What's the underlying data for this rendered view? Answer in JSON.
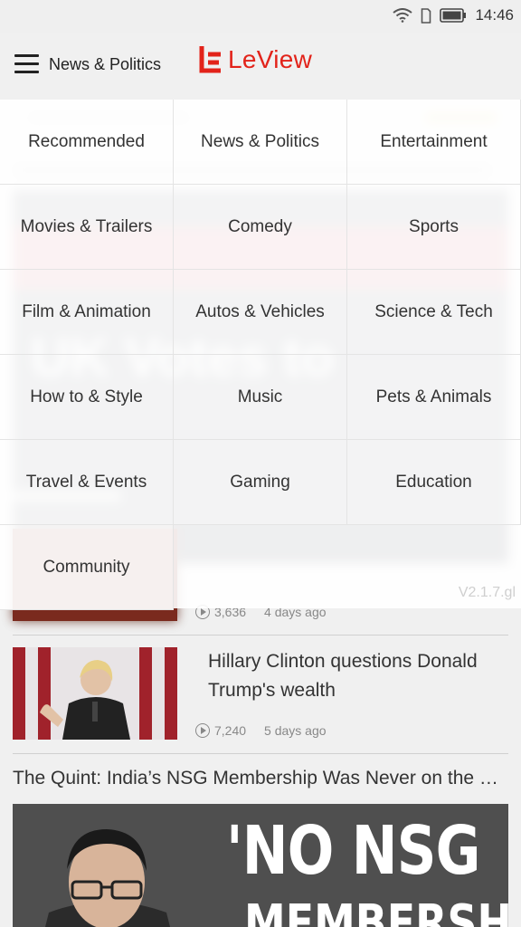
{
  "status": {
    "time": "14:46"
  },
  "header": {
    "title": "News & Politics",
    "logo_text": "LeView"
  },
  "categories": [
    "Recommended",
    "News & Politics",
    "Entertainment",
    "Movies & Trailers",
    "Comedy",
    "Sports",
    "Film & Animation",
    "Autos & Vehicles",
    "Science & Tech",
    "How to & Style",
    "Music",
    "Pets & Animals",
    "Travel & Events",
    "Gaming",
    "Education",
    "Community"
  ],
  "version": "V2.1.7.gl",
  "feed": {
    "item1": {
      "views": "3,636",
      "ago": "4 days ago"
    },
    "item2": {
      "title": "Hillary Clinton questions Donald Trump's wealth",
      "views": "7,240",
      "ago": "5 days ago"
    },
    "item3": {
      "title": "The Quint: India’s NSG Membership Was Never on the Cards",
      "image_text_1": "'NO NSG",
      "image_text_2": "MEMBERSHIP"
    }
  },
  "colors": {
    "brand": "#e2231a"
  }
}
